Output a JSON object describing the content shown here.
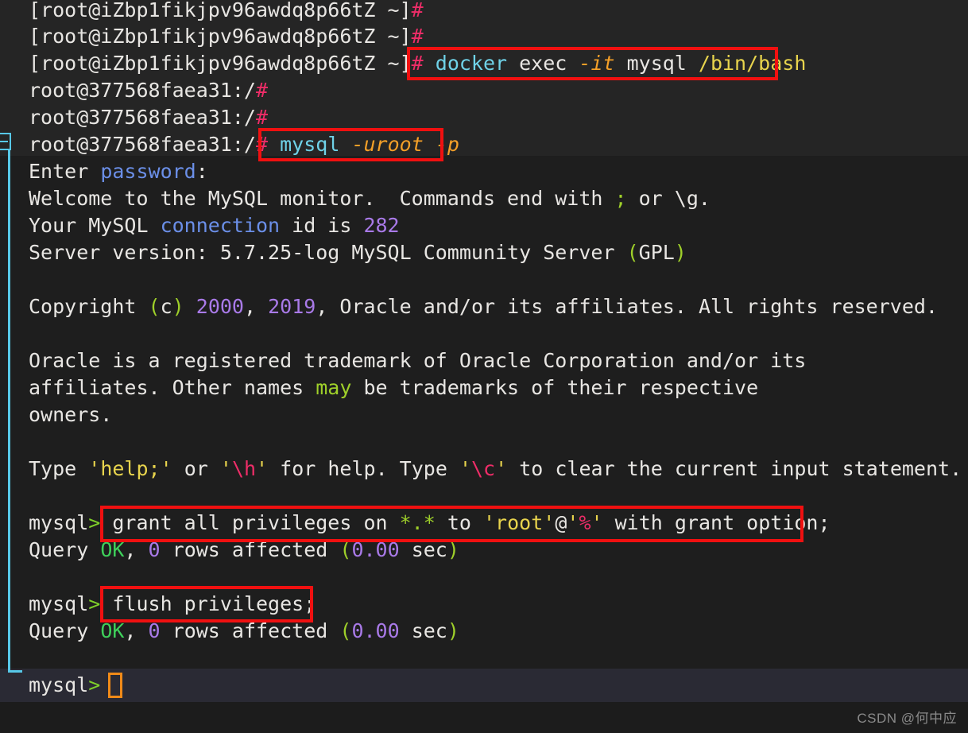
{
  "terminal": {
    "background_color": "#1c1c1c",
    "upper_band_color": "#252525",
    "current_line_color": "#2a2a34",
    "cursor_color": "#f08a18",
    "annotation_color": "#f01010",
    "fold_marker_color": "#57c8e8",
    "host_prompt": "[root@iZbp1fikjpv96awdq8p66tZ ~]",
    "container_prompt": "root@377568faea31:/",
    "prompt_hash": "#",
    "mysql_prompt": "mysql",
    "mysql_prompt_arrow": ">",
    "lines": {
      "l1": {
        "prompt": "[root@iZbp1fikjpv96awdq8p66tZ ~]",
        "hash": "#"
      },
      "l2": {
        "prompt": "[root@iZbp1fikjpv96awdq8p66tZ ~]",
        "hash": "#"
      },
      "l3": {
        "prompt": "[root@iZbp1fikjpv96awdq8p66tZ ~]",
        "hash": "#",
        "cmd_docker": "docker",
        "cmd_exec": " exec ",
        "cmd_flag": "-it",
        "cmd_mysql": " mysql ",
        "cmd_path": "/bin/bash"
      },
      "l4": {
        "prompt": "root@377568faea31:/",
        "hash": "#"
      },
      "l5": {
        "prompt": "root@377568faea31:/",
        "hash": "#"
      },
      "l6": {
        "prompt": "root@377568faea31:/",
        "hash": "#",
        "cmd_mysql": "mysql",
        "cmd_space": " ",
        "cmd_user": "-uroot",
        "cmd_space2": " ",
        "cmd_pass": "-p"
      },
      "l7": {
        "enter": "Enter ",
        "password": "password",
        "colon": ":"
      },
      "l8": {
        "a": "Welcome to the MySQL monitor.  Commands end with ",
        "semi": ";",
        "b": " or \\g."
      },
      "l9": {
        "a": "Your MySQL ",
        "connection": "connection",
        "b": " id is ",
        "id": "282"
      },
      "l10": {
        "a": "Server version: 5.7.25-log MySQL Community Server ",
        "lp": "(",
        "gpl": "GPL",
        "rp": ")"
      },
      "l11": {
        "copyright": "Copyright ",
        "lp": "(",
        "c": "c",
        "rp": ")",
        "sp": " ",
        "y1": "2000",
        "comma": ", ",
        "y2": "2019",
        "rest": ", Oracle and/or its affiliates. All rights reserved."
      },
      "l12": {
        "a": "Oracle is a registered trademark of Oracle Corporation and/or its"
      },
      "l13": {
        "a": "affiliates. Other names ",
        "may": "may",
        "b": " be trademarks of their respective"
      },
      "l14": {
        "a": "owners."
      },
      "l15": {
        "type1": "Type ",
        "q1": "'",
        "help": "help;",
        "q2": "'",
        "or": " or ",
        "q3": "'",
        "bsh": "\\h",
        "q4": "'",
        "mid": " for help. Type ",
        "q5": "'",
        "bsc": "\\c",
        "q6": "'",
        "end": " to clear the current input statement."
      },
      "l16": {
        "prompt": "mysql",
        "arrow": ">",
        "grant": " grant all privileges on ",
        "stars": "*.*",
        "to": " to ",
        "qroot": "'root'",
        "at": "@",
        "qpct_open": "'",
        "pct": "%",
        "qpct_close": "'",
        "tail": " with grant option;"
      },
      "l17": {
        "query": "Query ",
        "ok": "OK",
        "comma": ", ",
        "zero": "0",
        "rows": " rows affected ",
        "lp": "(",
        "time": "0.00",
        "sec": " sec",
        "rp": ")"
      },
      "l18": {
        "prompt": "mysql",
        "arrow": ">",
        "cmd": " flush privileges;"
      },
      "l19": {
        "query": "Query ",
        "ok": "OK",
        "comma": ", ",
        "zero": "0",
        "rows": " rows affected ",
        "lp": "(",
        "time": "0.00",
        "sec": " sec",
        "rp": ")"
      },
      "l20": {
        "prompt": "mysql",
        "arrow": ">"
      }
    },
    "annotations": [
      {
        "name": "docker-exec-command-highlight"
      },
      {
        "name": "mysql-login-command-highlight"
      },
      {
        "name": "grant-statement-highlight"
      },
      {
        "name": "flush-privileges-highlight"
      }
    ]
  },
  "watermark": {
    "text": "CSDN @何中应"
  }
}
